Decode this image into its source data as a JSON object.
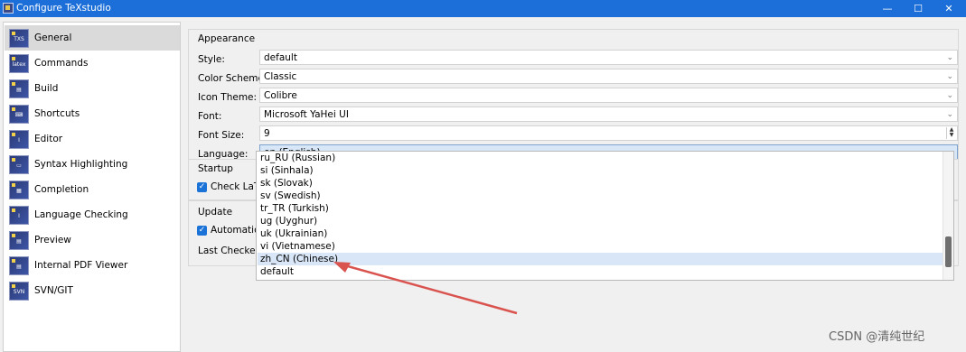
{
  "window": {
    "title": "Configure TeXstudio",
    "controls": {
      "minimize": "—",
      "maximize": "☐",
      "close": "✕"
    }
  },
  "sidebar": {
    "items": [
      {
        "label": "General",
        "icon": "txs-general-icon",
        "icon_text": "TXS",
        "selected": true
      },
      {
        "label": "Commands",
        "icon": "latex-commands-icon",
        "icon_text": "latex"
      },
      {
        "label": "Build",
        "icon": "build-icon",
        "icon_text": "▤"
      },
      {
        "label": "Shortcuts",
        "icon": "shortcuts-icon",
        "icon_text": "⌨"
      },
      {
        "label": "Editor",
        "icon": "editor-icon",
        "icon_text": "I"
      },
      {
        "label": "Syntax Highlighting",
        "icon": "syntax-highlighting-icon",
        "icon_text": "▭"
      },
      {
        "label": "Completion",
        "icon": "completion-icon",
        "icon_text": "▦"
      },
      {
        "label": "Language Checking",
        "icon": "language-checking-icon",
        "icon_text": "I"
      },
      {
        "label": "Preview",
        "icon": "preview-icon",
        "icon_text": "▤"
      },
      {
        "label": "Internal PDF Viewer",
        "icon": "pdf-viewer-icon",
        "icon_text": "▤"
      },
      {
        "label": "SVN/GIT",
        "icon": "svn-git-icon",
        "icon_text": "SVN"
      }
    ]
  },
  "appearance": {
    "title": "Appearance",
    "fields": [
      {
        "label": "Style:",
        "value": "default"
      },
      {
        "label": "Color Scheme:",
        "value": "Classic"
      },
      {
        "label": "Icon Theme:",
        "value": "Colibre"
      },
      {
        "label": "Font:",
        "value": "Microsoft YaHei UI"
      },
      {
        "label": "Font Size:",
        "value": "9"
      },
      {
        "label": "Language:",
        "value": "en  (English)"
      }
    ]
  },
  "startup": {
    "title": "Startup",
    "check_label": "Check LaTeX"
  },
  "update": {
    "title": "Update",
    "check_label": "Automaticall",
    "last_checked_label": "Last Checked:"
  },
  "language_dropdown": {
    "options": [
      "ru_RU  (Russian)",
      "si  (Sinhala)",
      "sk  (Slovak)",
      "sv  (Swedish)",
      "tr_TR  (Turkish)",
      "ug  (Uyghur)",
      "uk  (Ukrainian)",
      "vi  (Vietnamese)",
      "zh_CN  (Chinese)",
      "default"
    ],
    "highlighted": "zh_CN  (Chinese)"
  },
  "annotation": {
    "color": "#d9534f"
  },
  "watermark": "CSDN @清纯世纪"
}
